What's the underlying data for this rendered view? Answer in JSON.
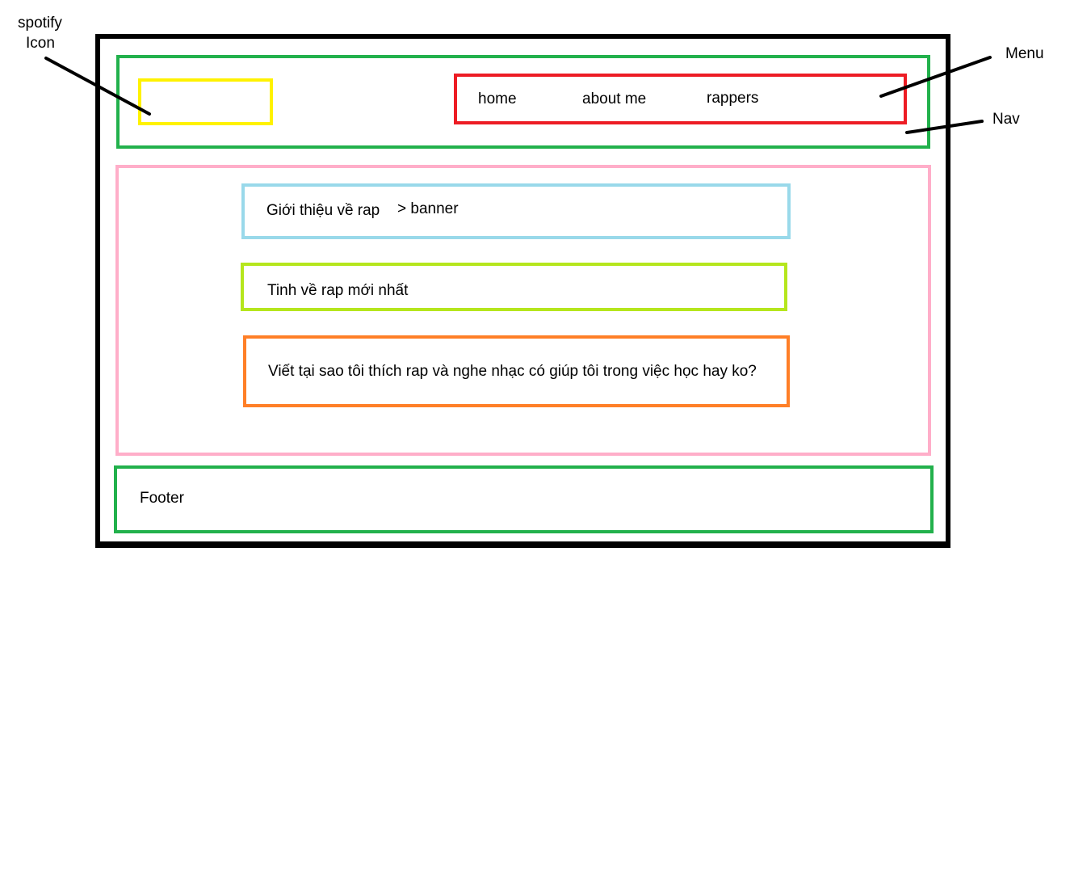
{
  "annotations": {
    "spotify_icon_line1": "spotify",
    "spotify_icon_line2": "Icon",
    "menu": "Menu",
    "nav": "Nav"
  },
  "nav": {
    "menu_items": [
      "home",
      "about me",
      "rappers"
    ]
  },
  "main": {
    "banner_text": "Giới thiệu về rap",
    "banner_note": "> banner",
    "news_text": "Tinh về rap mới nhất",
    "essay_text": "Viết tại sao tôi thích rap và nghe nhạc có giúp tôi trong việc học hay ko?"
  },
  "footer": {
    "label": "Footer"
  },
  "colors": {
    "frame": "#000000",
    "nav_box": "#22b14c",
    "logo_box": "#fff200",
    "menu_box": "#ed1c24",
    "main_box": "#ffaec9",
    "banner_box": "#99d9ea",
    "news_box": "#b5e61d",
    "essay_box": "#ff7f27",
    "footer_box": "#22b14c"
  }
}
